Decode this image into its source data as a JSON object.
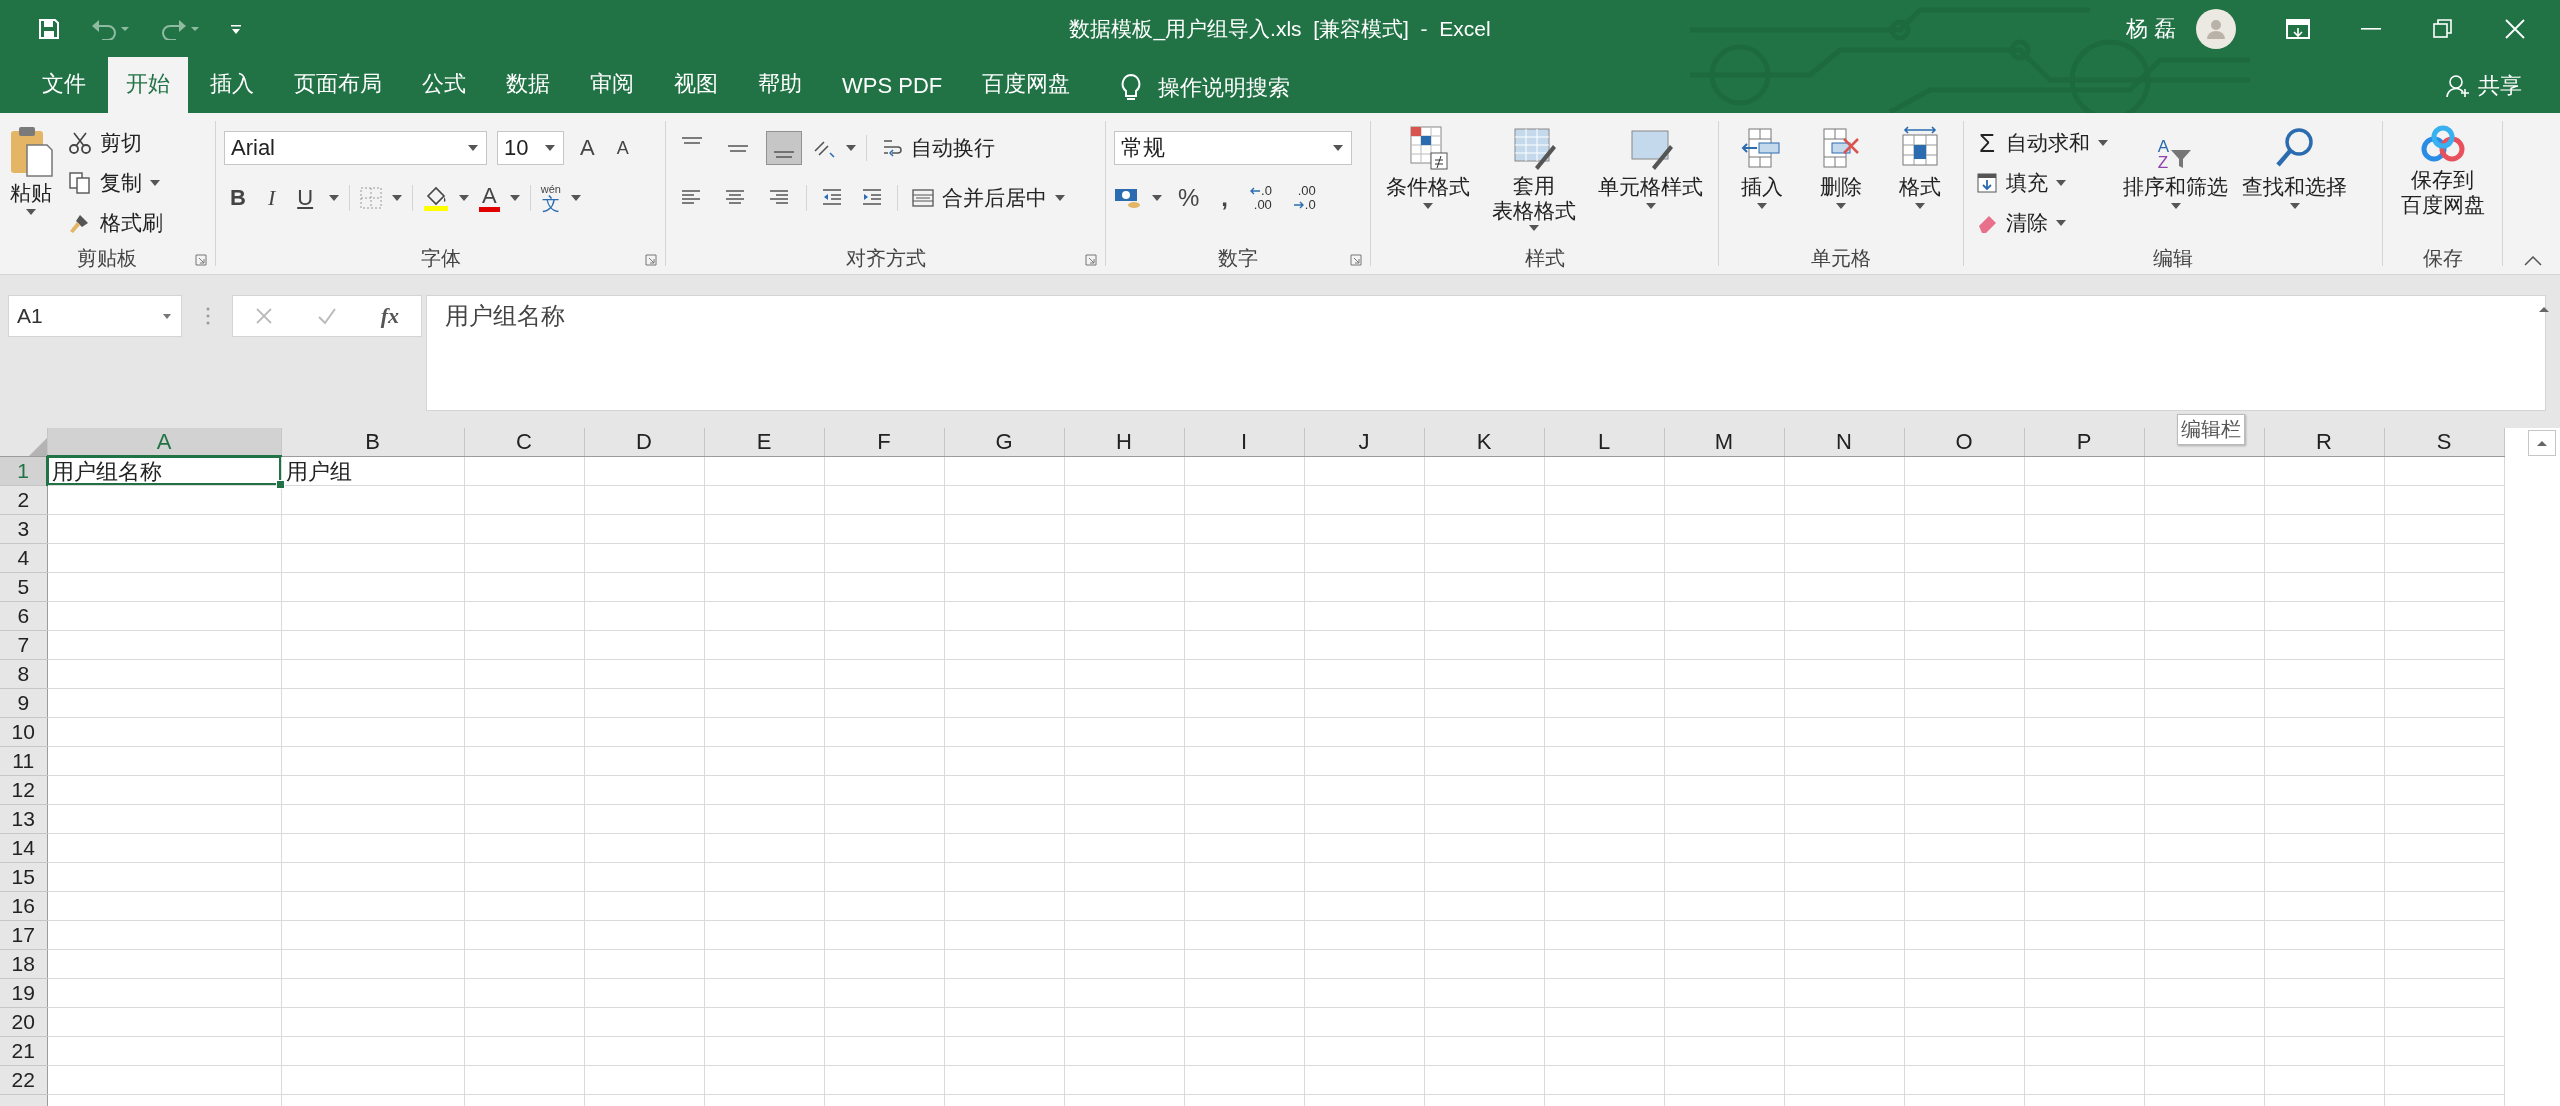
{
  "window": {
    "title": "数据模板_用户组导入.xls  [兼容模式]  -  Excel",
    "user": "杨 磊"
  },
  "tabs": [
    {
      "label": "文件",
      "selected": false
    },
    {
      "label": "开始",
      "selected": true
    },
    {
      "label": "插入",
      "selected": false
    },
    {
      "label": "页面布局",
      "selected": false
    },
    {
      "label": "公式",
      "selected": false
    },
    {
      "label": "数据",
      "selected": false
    },
    {
      "label": "审阅",
      "selected": false
    },
    {
      "label": "视图",
      "selected": false
    },
    {
      "label": "帮助",
      "selected": false
    },
    {
      "label": "WPS PDF",
      "selected": false
    },
    {
      "label": "百度网盘",
      "selected": false
    }
  ],
  "tell_me": "操作说明搜索",
  "share": "共享",
  "clipboard": {
    "label": "剪贴板",
    "paste": "粘贴",
    "cut": "剪切",
    "copy": "复制",
    "format_painter": "格式刷"
  },
  "font": {
    "label": "字体",
    "name": "Arial",
    "size": "10",
    "grow": "A",
    "shrink": "A",
    "bold": "B",
    "italic": "I",
    "underline": "U",
    "font_color": "A",
    "phonetic_ruby": "wén",
    "phonetic_base": "文"
  },
  "alignment": {
    "label": "对齐方式",
    "vertical": [
      {
        "kind": "top",
        "selected": false
      },
      {
        "kind": "middle",
        "selected": false
      },
      {
        "kind": "bottom",
        "selected": true
      }
    ],
    "wrap_text": "自动换行",
    "merge": "合并后居中"
  },
  "number": {
    "label": "数字",
    "format": "常规",
    "percent": "%",
    "comma": ",",
    "decimals": [
      {
        "kind": "increase",
        "top": ".0",
        "bottom": ".00"
      },
      {
        "kind": "decrease",
        "top": ".00",
        "bottom": ".0"
      }
    ]
  },
  "styles": {
    "label": "样式",
    "buttons": [
      {
        "kind": "conditional",
        "text": "条件格式"
      },
      {
        "kind": "table",
        "text": "套用表格格式"
      },
      {
        "kind": "cell",
        "text": "单元格样式"
      }
    ]
  },
  "cells": {
    "label": "单元格",
    "buttons": [
      {
        "kind": "insert",
        "text": "插入"
      },
      {
        "kind": "delete",
        "text": "删除"
      },
      {
        "kind": "format",
        "text": "格式"
      }
    ]
  },
  "editing": {
    "label": "编辑",
    "autosum_symbol": "Σ",
    "autosum": "自动求和",
    "fill": "填充",
    "clear": "清除",
    "sort": "排序和筛选",
    "sort_letters": [
      "A",
      "Z"
    ],
    "find": "查找和选择"
  },
  "save": {
    "label": "保存",
    "button": "保存到百度网盘"
  },
  "formula_bar": {
    "name_box": "A1",
    "fx": "fx",
    "content": "用户组名称",
    "tooltip": "编辑栏"
  },
  "sheet": {
    "columns": [
      {
        "label": "A",
        "selected": true
      },
      {
        "label": "B",
        "selected": false
      },
      {
        "label": "C",
        "selected": false
      },
      {
        "label": "D",
        "selected": false
      },
      {
        "label": "E",
        "selected": false
      },
      {
        "label": "F",
        "selected": false
      },
      {
        "label": "G",
        "selected": false
      },
      {
        "label": "H",
        "selected": false
      },
      {
        "label": "I",
        "selected": false
      },
      {
        "label": "J",
        "selected": false
      },
      {
        "label": "K",
        "selected": false
      },
      {
        "label": "L",
        "selected": false
      },
      {
        "label": "M",
        "selected": false
      },
      {
        "label": "N",
        "selected": false
      },
      {
        "label": "O",
        "selected": false
      },
      {
        "label": "P",
        "selected": false
      },
      {
        "selected": false
      },
      {
        "label": "R",
        "selected": false
      },
      {
        "label": "S",
        "selected": false
      }
    ],
    "rows": [
      {
        "label": "1",
        "selected": true,
        "cells": [
          {
            "text": "用户组名称",
            "active": true
          },
          {
            "text": "用户组",
            "active": false
          }
        ]
      },
      {
        "label": "2",
        "selected": false
      },
      {
        "label": "3",
        "selected": false
      },
      {
        "label": "4",
        "selected": false
      },
      {
        "label": "5",
        "selected": false
      },
      {
        "label": "6",
        "selected": false
      },
      {
        "label": "7",
        "selected": false
      },
      {
        "label": "8",
        "selected": false
      },
      {
        "label": "9",
        "selected": false
      },
      {
        "label": "10",
        "selected": false
      },
      {
        "label": "11",
        "selected": false
      },
      {
        "label": "12",
        "selected": false
      },
      {
        "label": "13",
        "selected": false
      },
      {
        "label": "14",
        "selected": false
      },
      {
        "label": "15",
        "selected": false
      },
      {
        "label": "16",
        "selected": false
      },
      {
        "label": "17",
        "selected": false
      },
      {
        "label": "18",
        "selected": false
      },
      {
        "label": "19",
        "selected": false
      },
      {
        "label": "20",
        "selected": false
      },
      {
        "label": "21",
        "selected": false
      },
      {
        "label": "22",
        "selected": false
      }
    ]
  }
}
